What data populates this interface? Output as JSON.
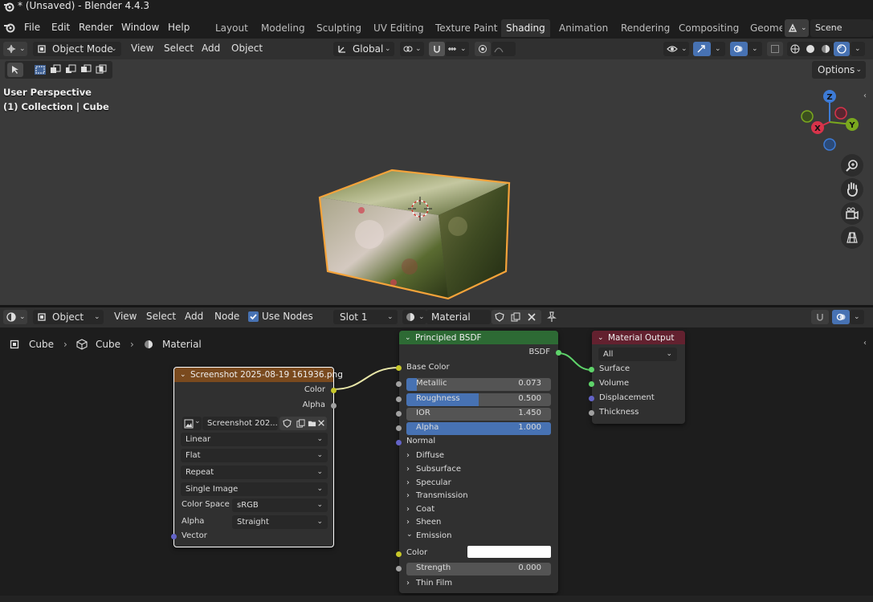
{
  "window": {
    "title": "* (Unsaved) - Blender 4.4.3"
  },
  "menu": [
    "File",
    "Edit",
    "Render",
    "Window",
    "Help"
  ],
  "workspace_tabs": [
    "Layout",
    "Modeling",
    "Sculpting",
    "UV Editing",
    "Texture Paint",
    "Shading",
    "Animation",
    "Rendering",
    "Compositing",
    "Geome"
  ],
  "active_workspace": "Shading",
  "scene": {
    "label": "Scene"
  },
  "viewport_header": {
    "mode": "Object Mode",
    "menus": [
      "View",
      "Select",
      "Add",
      "Object"
    ],
    "transform_orientation": "Global",
    "options_label": "Options"
  },
  "viewport": {
    "perspective": "User Perspective",
    "collection": "(1) Collection | Cube",
    "gizmo": {
      "z": "Z",
      "y": "Y",
      "x": "X"
    }
  },
  "node_header": {
    "type": "Object",
    "menus": [
      "View",
      "Select",
      "Add",
      "Node"
    ],
    "use_nodes_label": "Use Nodes",
    "use_nodes": true,
    "slot": "Slot 1",
    "material": "Material"
  },
  "breadcrumb": [
    "Cube",
    "Cube",
    "Material"
  ],
  "image_node": {
    "title": "Screenshot 2025-08-19 161936.png",
    "out_color": "Color",
    "out_alpha": "Alpha",
    "image_name": "Screenshot 202...",
    "interpolation": "Linear",
    "projection": "Flat",
    "extension": "Repeat",
    "source": "Single Image",
    "color_space_label": "Color Space",
    "color_space": "sRGB",
    "alpha_label": "Alpha",
    "alpha_mode": "Straight",
    "in_vector": "Vector"
  },
  "bsdf_node": {
    "title": "Principled BSDF",
    "out_bsdf": "BSDF",
    "base_color": "Base Color",
    "metallic": {
      "label": "Metallic",
      "value": "0.073",
      "fill": 0.073
    },
    "roughness": {
      "label": "Roughness",
      "value": "0.500",
      "fill": 0.5
    },
    "ior": {
      "label": "IOR",
      "value": "1.450"
    },
    "alpha": {
      "label": "Alpha",
      "value": "1.000",
      "fill": 1.0
    },
    "normal": "Normal",
    "panels": [
      "Diffuse",
      "Subsurface",
      "Specular",
      "Transmission",
      "Coat",
      "Sheen"
    ],
    "emission": "Emission",
    "emission_color": "Color",
    "emission_strength": {
      "label": "Strength",
      "value": "0.000"
    },
    "thin_film": "Thin Film"
  },
  "output_node": {
    "title": "Material Output",
    "target": "All",
    "surface": "Surface",
    "volume": "Volume",
    "displacement": "Displacement",
    "thickness": "Thickness"
  },
  "colors": {
    "accent": "#4772b3",
    "shader_head": "#2d6a34",
    "texture_head": "#7a4a1e",
    "output_head": "#63212f",
    "selection_outline": "#f5a33a"
  }
}
